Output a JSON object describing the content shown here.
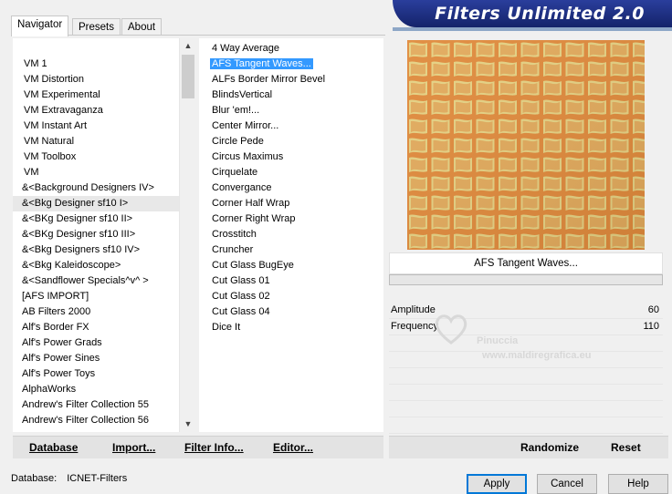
{
  "tabs": [
    {
      "label": "Navigator",
      "active": true
    },
    {
      "label": "Presets",
      "active": false
    },
    {
      "label": "About",
      "active": false
    }
  ],
  "banner": {
    "title": "Filters Unlimited 2.0"
  },
  "categories": [
    "VM 1",
    "VM Distortion",
    "VM Experimental",
    "VM Extravaganza",
    "VM Instant Art",
    "VM Natural",
    "VM Toolbox",
    "VM",
    "&<Background Designers IV>",
    "&<Bkg Designer sf10 I>",
    "&<BKg Designer sf10 II>",
    "&<BKg Designer sf10 III>",
    "&<Bkg Designers sf10 IV>",
    "&<Bkg Kaleidoscope>",
    "&<Sandflower Specials^v^ >",
    "[AFS IMPORT]",
    "AB Filters 2000",
    "Alf's Border FX",
    "Alf's Power Grads",
    "Alf's Power Sines",
    "Alf's Power Toys",
    "AlphaWorks",
    "Andrew's Filter Collection 55",
    "Andrew's Filter Collection 56"
  ],
  "selected_category_index": 9,
  "filters": [
    "4 Way Average",
    "AFS Tangent Waves...",
    "ALFs Border Mirror Bevel",
    "BlindsVertical",
    "Blur 'em!...",
    "Center Mirror...",
    "Circle Pede",
    "Circus Maximus",
    "Cirquelate",
    "Convergance",
    "Corner Half Wrap",
    "Corner Right Wrap",
    "Crosstitch",
    "Cruncher",
    "Cut Glass  BugEye",
    "Cut Glass 01",
    "Cut Glass 02",
    "Cut Glass 04",
    "Dice It"
  ],
  "selected_filter_index": 1,
  "buttons": {
    "database": "Database",
    "import": "Import...",
    "filter_info": "Filter Info...",
    "editor": "Editor...",
    "randomize": "Randomize",
    "reset": "Reset",
    "apply": "Apply",
    "cancel": "Cancel",
    "help": "Help"
  },
  "preview": {
    "filter_name": "AFS Tangent Waves...",
    "color_dark": "#e08a3c",
    "color_light": "#e6d98a"
  },
  "params": [
    {
      "label": "Amplitude",
      "value": "60"
    },
    {
      "label": "Frequency",
      "value": "110"
    }
  ],
  "watermark": {
    "name": "Pinuccia",
    "site": "www.maldiregrafica.eu"
  },
  "status": {
    "database_label": "Database:",
    "database_value": "ICNET-Filters"
  }
}
